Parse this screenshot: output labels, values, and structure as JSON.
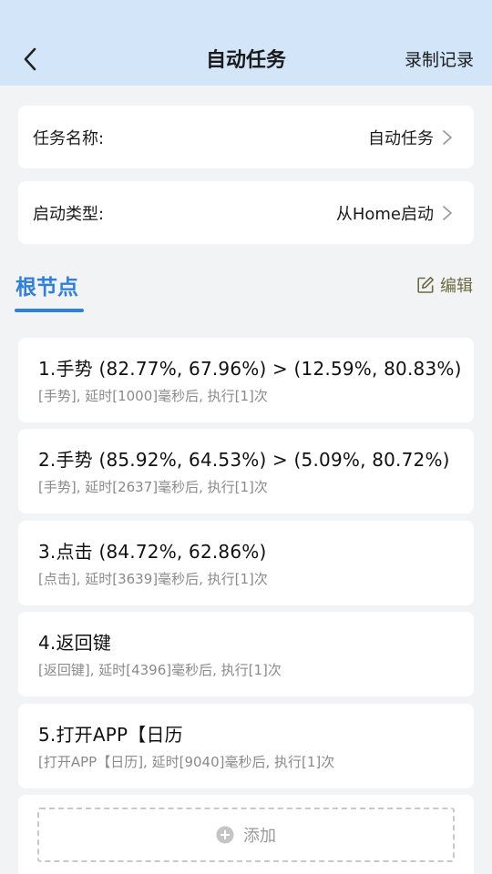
{
  "header": {
    "title": "自动任务",
    "record_label": "录制记录"
  },
  "settings": {
    "task_name": {
      "label": "任务名称:",
      "value": "自动任务"
    },
    "start_type": {
      "label": "启动类型:",
      "value": "从Home启动"
    }
  },
  "section": {
    "tab_label": "根节点",
    "edit_label": "编辑"
  },
  "tasks": [
    {
      "title": "1.手势 (82.77%, 67.96%) > (12.59%, 80.83%)",
      "desc": "[手势], 延时[1000]毫秒后, 执行[1]次"
    },
    {
      "title": "2.手势 (85.92%, 64.53%) > (5.09%, 80.72%)",
      "desc": "[手势], 延时[2637]毫秒后, 执行[1]次"
    },
    {
      "title": "3.点击 (84.72%, 62.86%)",
      "desc": "[点击], 延时[3639]毫秒后, 执行[1]次"
    },
    {
      "title": "4.返回键",
      "desc": "[返回键], 延时[4396]毫秒后, 执行[1]次"
    },
    {
      "title": "5.打开APP【日历",
      "desc": "[打开APP【日历], 延时[9040]毫秒后, 执行[1]次"
    }
  ],
  "add": {
    "label": "添加"
  },
  "colors": {
    "header_bg": "#d3e5f8",
    "accent": "#2f7fdc",
    "edit": "#6b6b3f",
    "page_bg": "#f2f3f5"
  }
}
